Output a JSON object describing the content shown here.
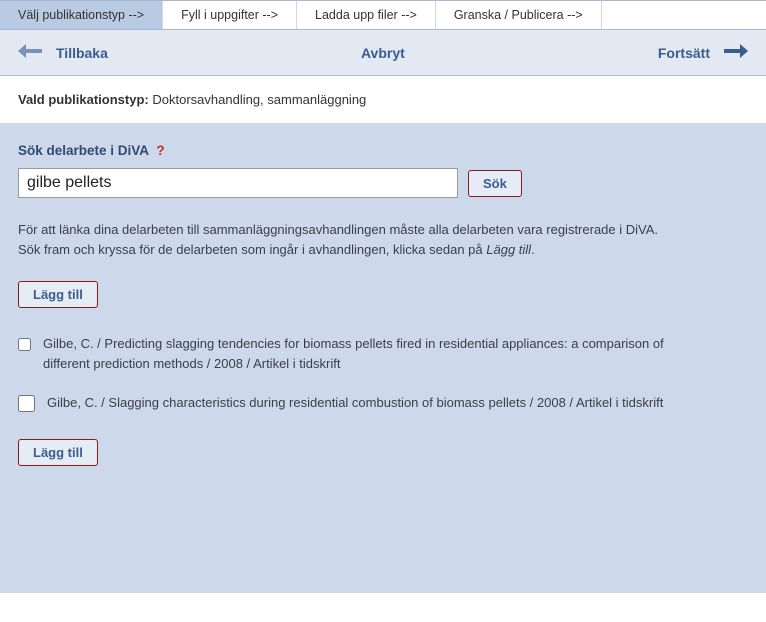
{
  "tabs": [
    {
      "label": "Välj publikationstyp -->"
    },
    {
      "label": "Fyll i uppgifter -->"
    },
    {
      "label": "Ladda upp filer -->"
    },
    {
      "label": "Granska / Publicera -->"
    }
  ],
  "nav": {
    "back": "Tillbaka",
    "cancel": "Avbryt",
    "continue": "Fortsätt"
  },
  "pubtype": {
    "label": "Vald publikationstyp:",
    "value": "Doktorsavhandling, sammanläggning"
  },
  "search": {
    "label": "Sök delarbete i DiVA",
    "help": "?",
    "value": "gilbe pellets",
    "button": "Sök"
  },
  "instructions": {
    "p1": "För att länka dina delarbeten till sammanläggningsavhandlingen måste alla delarbeten vara registrerade i DiVA.",
    "p2a": "Sök fram och kryssa för de delarbeten som ingår i avhandlingen, klicka sedan på ",
    "p2b": "Lägg till",
    "p2c": "."
  },
  "addButton": "Lägg till",
  "results": [
    {
      "text": "Gilbe, C. / Predicting slagging tendencies for biomass pellets fired in residential appliances: a comparison of different prediction methods / 2008 / Artikel i tidskrift"
    },
    {
      "text": "Gilbe, C. / Slagging characteristics during residential combustion of biomass pellets / 2008 / Artikel i tidskrift"
    }
  ]
}
